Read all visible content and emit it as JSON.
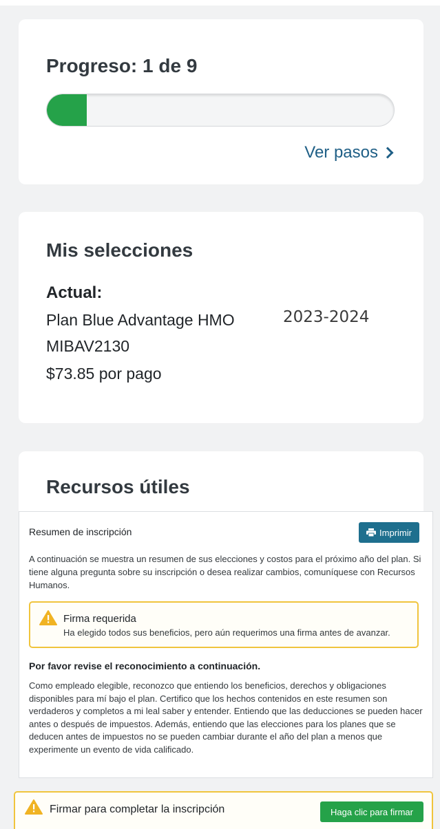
{
  "progress": {
    "title": "Progreso: 1 de 9",
    "value": 0.115,
    "link_label": "Ver pasos"
  },
  "selections": {
    "title": "Mis selecciones",
    "current_label": "Actual:",
    "plan_name": "Plan Blue Advantage HMO",
    "plan_year": "2023-2024",
    "plan_code": "MIBAV2130",
    "plan_cost": "$73.85 por pago"
  },
  "resources": {
    "title": "Recursos útiles"
  },
  "summary": {
    "title": "Resumen de inscripción",
    "print_label": "Imprimir",
    "intro": "A continuación se muestra un resumen de sus elecciones y costos para el próximo año del plan. Si tiene alguna pregunta sobre su inscripción o desea realizar cambios, comuníquese con Recursos Humanos.",
    "warning_title": "Firma requerida",
    "warning_text": "Ha elegido todos sus beneficios, pero aún requerimos una firma antes de avanzar.",
    "ack_title": "Por favor revise el reconocimiento a continuación.",
    "ack_text": "Como empleado elegible, reconozco que entiendo los beneficios, derechos y obligaciones disponibles para mí bajo el plan. Certifico que los hechos contenidos en este resumen son verdaderos y completos a mi leal saber y entender. Entiendo que las deducciones se pueden hacer antes o después de impuestos. Además, entiendo que las elecciones para los planes que se deducen antes de impuestos no se pueden cambiar durante el año del plan a menos que experimente un evento de vida calificado."
  },
  "sign": {
    "text": "Firmar para completar la inscripción",
    "button_label": "Haga clic para firmar"
  },
  "colors": {
    "primary_green": "#25a249",
    "link_blue": "#1f5f86",
    "print_button": "#1e6f8e",
    "warning": "#f0c43c"
  },
  "icons": [
    "chevron-right-icon",
    "printer-icon",
    "warning-icon"
  ]
}
